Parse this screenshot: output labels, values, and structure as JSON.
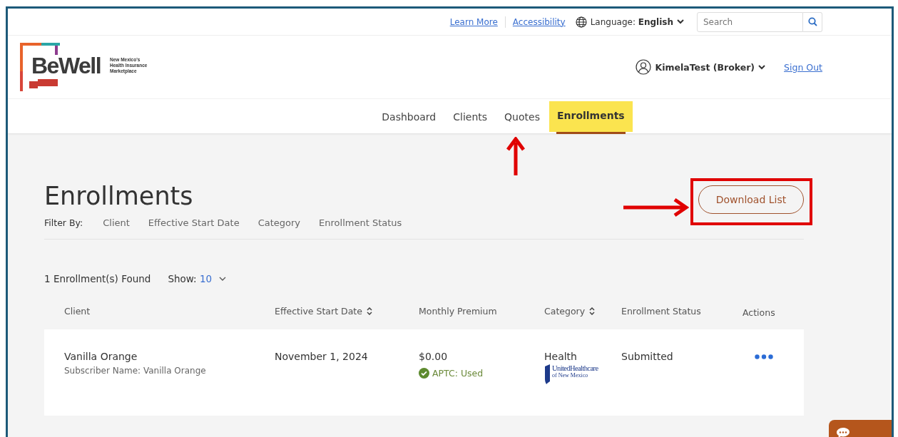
{
  "top_bar": {
    "links": [
      "Learn More",
      "Accessibility"
    ],
    "language_label": "Language:",
    "language_value": "English",
    "search": {
      "placeholder": "Search"
    }
  },
  "header": {
    "logo": {
      "name": "BeWell",
      "tagline": [
        "New Mexico's",
        "Health Insurance",
        "Marketplace"
      ]
    },
    "user": "KimelaTest (Broker)",
    "sign_out": "Sign Out"
  },
  "nav": [
    {
      "label": "Dashboard",
      "selected": false
    },
    {
      "label": "Clients",
      "selected": false
    },
    {
      "label": "Quotes",
      "selected": false
    },
    {
      "label": "Enrollments",
      "selected": true
    }
  ],
  "page": {
    "title": "Enrollments",
    "download_button": "Download List",
    "filter_label": "Filter By:",
    "filters": [
      "Client",
      "Effective Start Date",
      "Category",
      "Enrollment Status"
    ],
    "found": "1 Enrollment(s) Found",
    "show_label": "Show:",
    "show_value": "10"
  },
  "table": {
    "columns": [
      {
        "label": "Client",
        "sortable": false
      },
      {
        "label": "Effective Start Date",
        "sortable": true
      },
      {
        "label": "Monthly Premium",
        "sortable": false
      },
      {
        "label": "Category",
        "sortable": true
      },
      {
        "label": "Enrollment Status",
        "sortable": false
      },
      {
        "label": "Actions",
        "sortable": false
      }
    ],
    "rows": [
      {
        "client": "Vanilla Orange",
        "subscriber": "Subscriber Name: Vanilla Orange",
        "start_date": "November 1, 2024",
        "premium": "$0.00",
        "aptc": "APTC: Used",
        "category": "Health",
        "carrier": [
          "UnitedHealthcare",
          "of New Mexico"
        ],
        "status": "Submitted"
      }
    ]
  }
}
